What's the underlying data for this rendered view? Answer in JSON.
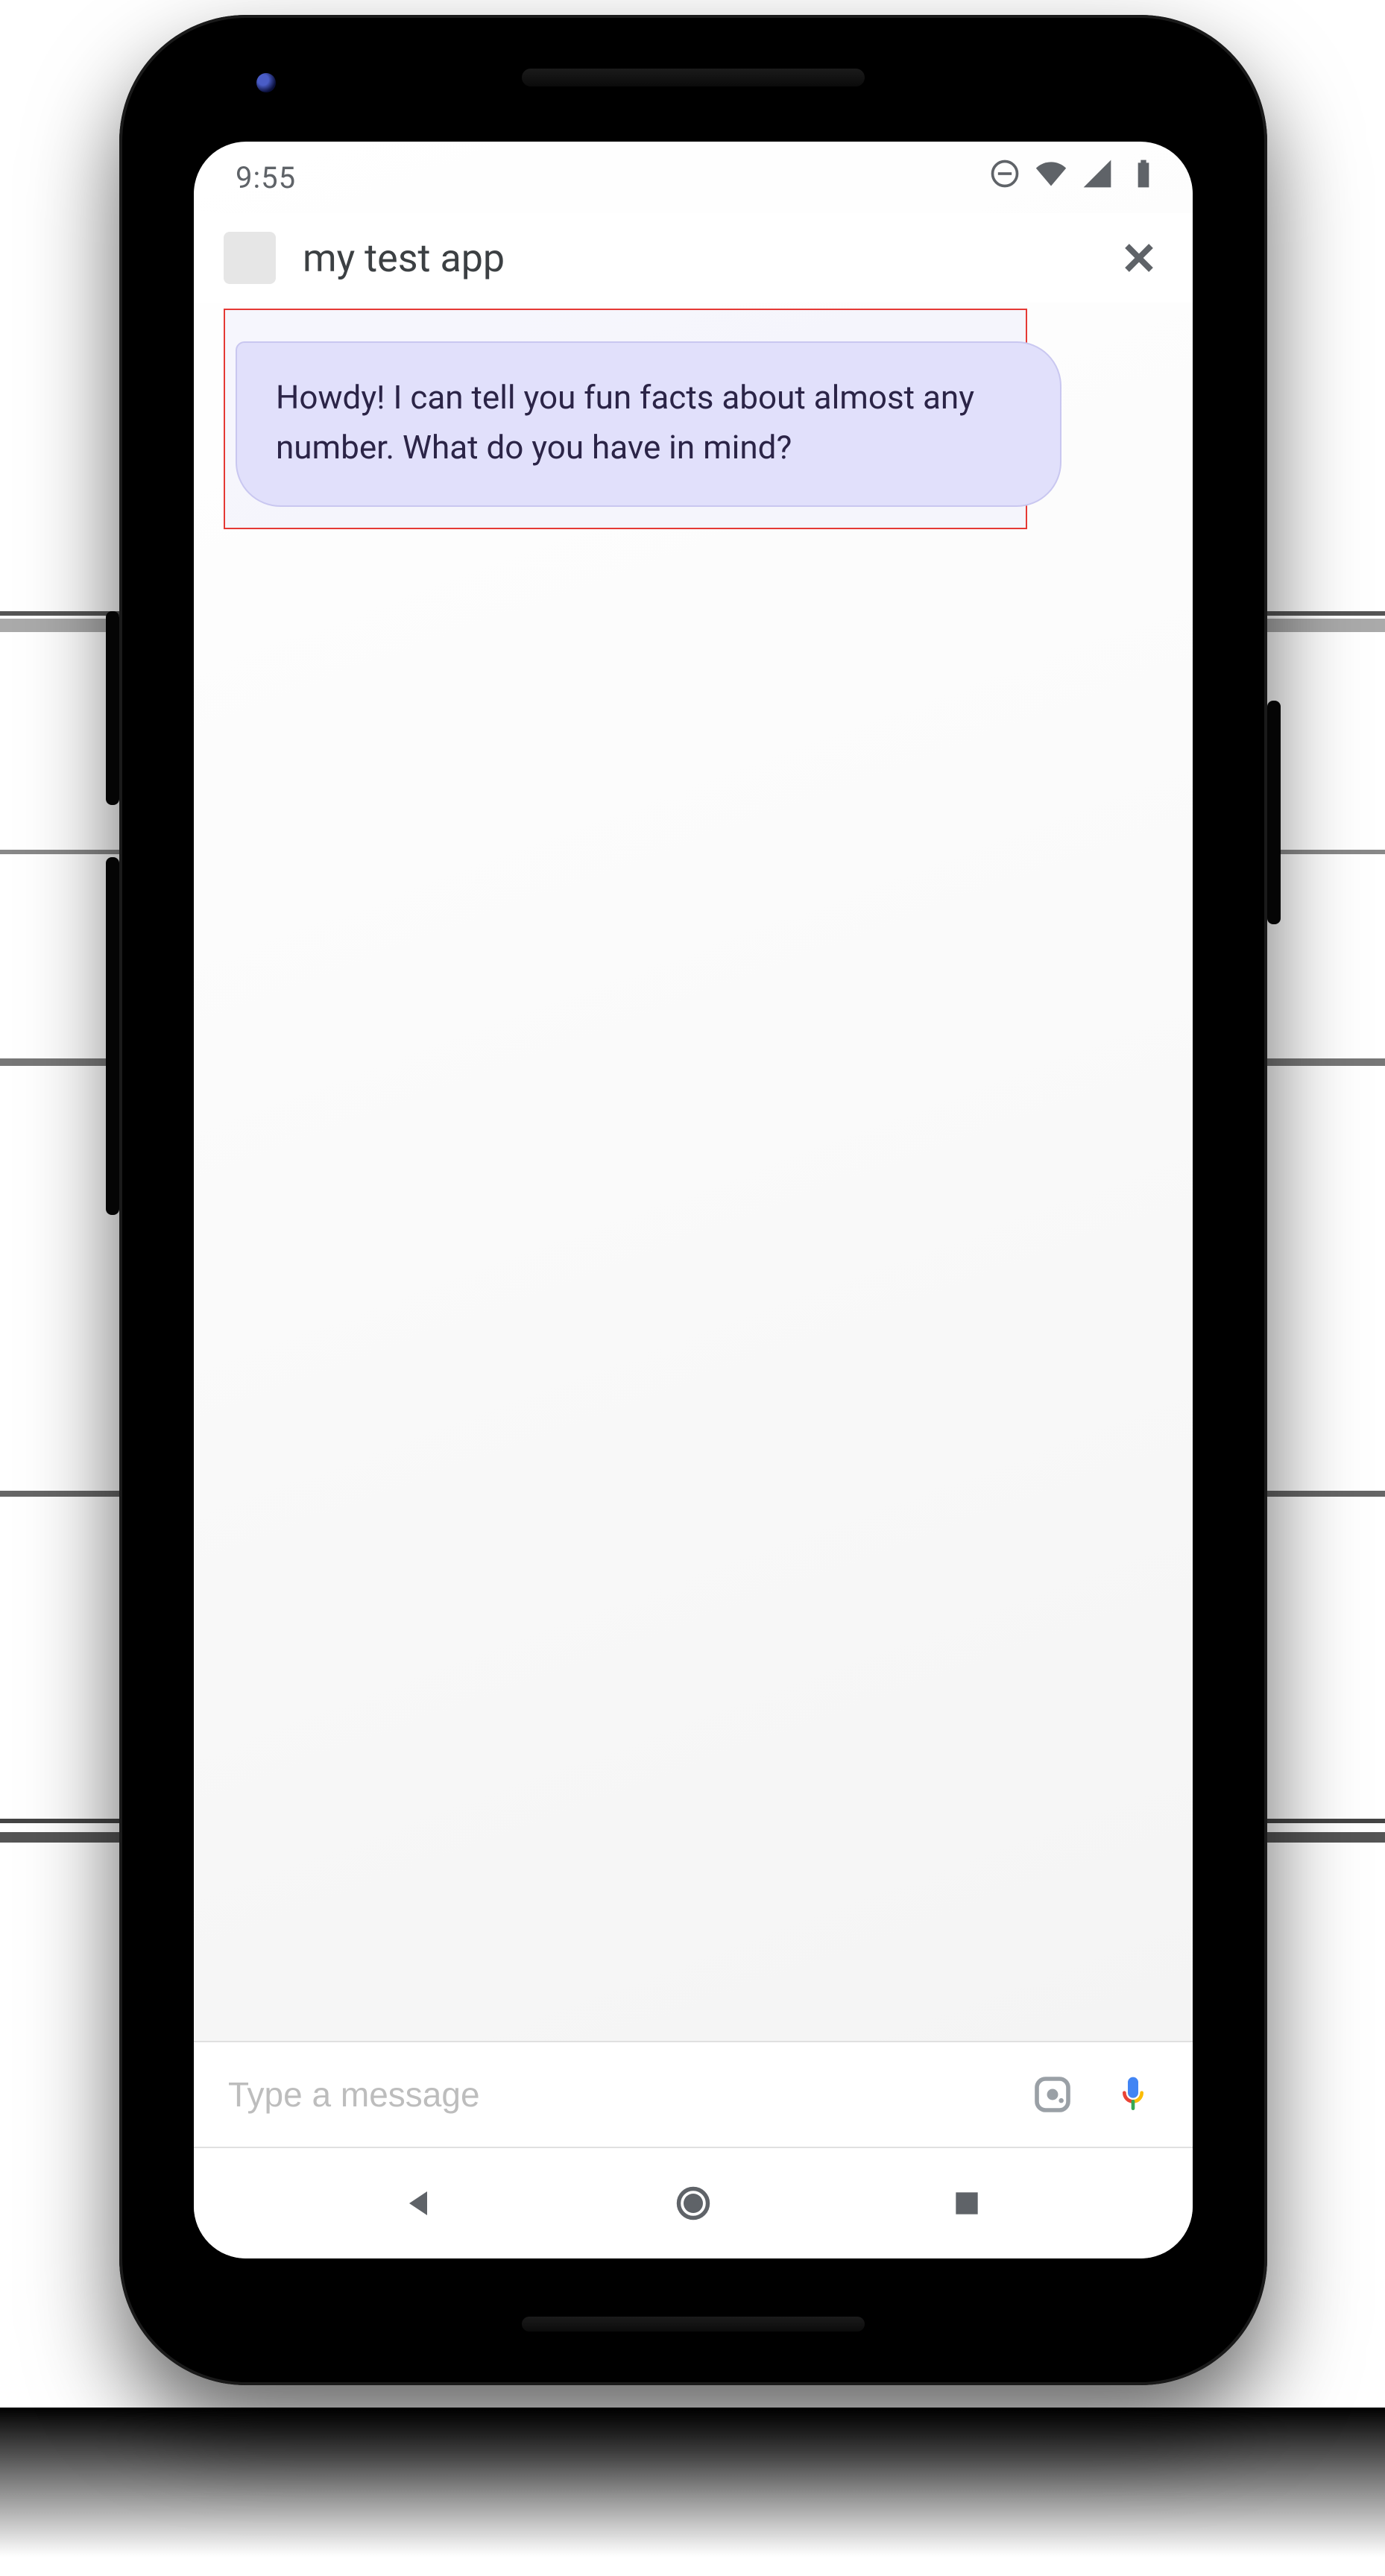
{
  "status": {
    "time": "9:55",
    "icons": {
      "dnd": "dnd-icon",
      "wifi": "wifi-icon",
      "cell": "cell-signal-icon",
      "battery": "battery-icon"
    }
  },
  "header": {
    "app_title": "my test app",
    "close_label": "Close"
  },
  "chat": {
    "messages": [
      {
        "from": "bot",
        "text": "Howdy! I can tell you fun facts about almost any number. What do you have in mind?"
      }
    ],
    "highlighted_index": 0
  },
  "input": {
    "placeholder": "Type a message",
    "value": "",
    "lens_label": "Google Lens",
    "mic_label": "Voice input"
  },
  "nav": {
    "back_label": "Back",
    "home_label": "Home",
    "recent_label": "Recent apps"
  },
  "colors": {
    "bubble_bg": "#e1e0fb",
    "highlight": "#e53935"
  }
}
